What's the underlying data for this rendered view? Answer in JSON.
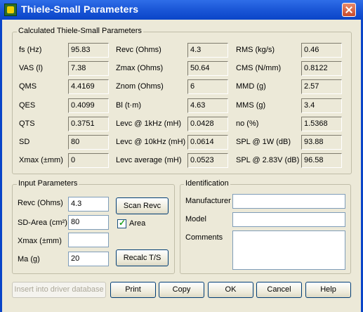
{
  "window": {
    "title": "Thiele-Small Parameters"
  },
  "calc": {
    "legend": "Calculated Thiele-Small Parameters",
    "col1": [
      {
        "label": "fs (Hz)",
        "value": "95.83"
      },
      {
        "label": "VAS (l)",
        "value": "7.38"
      },
      {
        "label": "QMS",
        "value": "4.4169"
      },
      {
        "label": "QES",
        "value": "0.4099"
      },
      {
        "label": "QTS",
        "value": "0.3751"
      },
      {
        "label": "SD",
        "value": "80"
      },
      {
        "label": "Xmax (±mm)",
        "value": "0"
      }
    ],
    "col2": [
      {
        "label": "Revc (Ohms)",
        "value": "4.3"
      },
      {
        "label": "Zmax (Ohms)",
        "value": "50.64"
      },
      {
        "label": "Znom (Ohms)",
        "value": "6"
      },
      {
        "label": "Bl (t·m)",
        "value": "4.63"
      },
      {
        "label": "Levc @ 1kHz (mH)",
        "value": "0.0428"
      },
      {
        "label": "Levc @ 10kHz (mH)",
        "value": "0.0614"
      },
      {
        "label": "Levc average (mH)",
        "value": "0.0523"
      }
    ],
    "col3": [
      {
        "label": "RMS (kg/s)",
        "value": "0.46"
      },
      {
        "label": "CMS (N/mm)",
        "value": "0.8122"
      },
      {
        "label": "MMD (g)",
        "value": "2.57"
      },
      {
        "label": "MMS (g)",
        "value": "3.4"
      },
      {
        "label": "no (%)",
        "value": "1.5368"
      },
      {
        "label": "SPL @ 1W (dB)",
        "value": "93.88"
      },
      {
        "label": "SPL @ 2.83V (dB)",
        "value": "96.58"
      }
    ]
  },
  "input": {
    "legend": "Input Parameters",
    "revc": {
      "label": "Revc (Ohms)",
      "value": "4.3"
    },
    "sd": {
      "label": "SD-Area (cm²)",
      "value": "80"
    },
    "xmax": {
      "label": "Xmax (±mm)",
      "value": ""
    },
    "ma": {
      "label": "Ma (g)",
      "value": "20"
    },
    "scan_button": "Scan Revc",
    "area_checkbox": {
      "label": "Area",
      "checked": true
    },
    "recalc_button": "Recalc T/S"
  },
  "ident": {
    "legend": "Identification",
    "manufacturer": {
      "label": "Manufacturer",
      "value": ""
    },
    "model": {
      "label": "Model",
      "value": ""
    },
    "comments": {
      "label": "Comments",
      "value": ""
    }
  },
  "buttons": {
    "insert": "Insert into driver database",
    "print": "Print",
    "copy": "Copy",
    "ok": "OK",
    "cancel": "Cancel",
    "help": "Help"
  }
}
